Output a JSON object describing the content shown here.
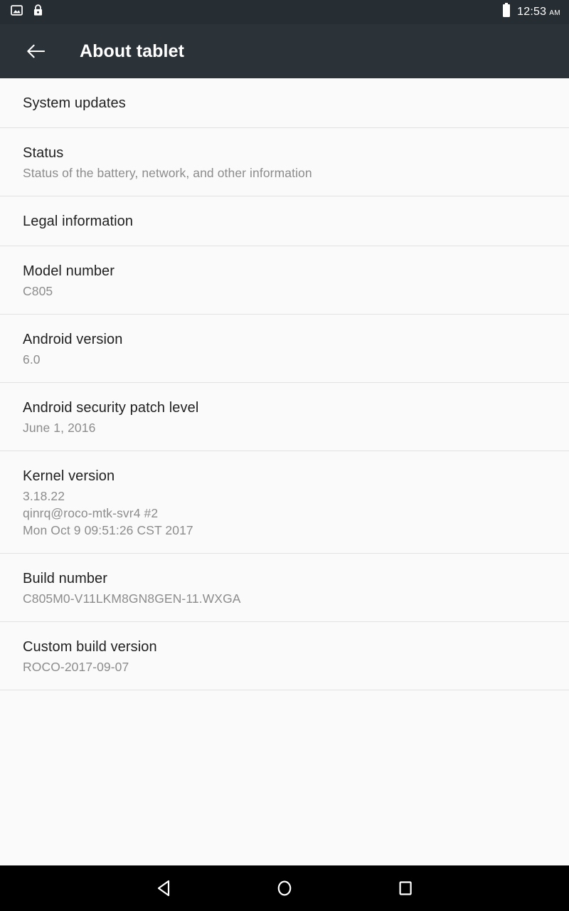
{
  "status_bar": {
    "left_icons": [
      {
        "name": "image-icon",
        "label": "Screenshot captured"
      },
      {
        "name": "lock-icon",
        "label": "Screen lock"
      }
    ],
    "right_icons": [
      {
        "name": "battery-icon",
        "label": "Battery full"
      }
    ],
    "time": "12:53",
    "am_pm": "AM",
    "background_color": "#262d33"
  },
  "app_bar": {
    "back_label": "Navigate up",
    "title": "About tablet",
    "background_color": "#2b3238",
    "title_color": "#ffffff"
  },
  "colors": {
    "page_background": "#fafafa",
    "divider": "#e2e2e2",
    "row_title": "#1f1f1f",
    "row_subtitle": "#8c8c8c",
    "nav_background": "#000000"
  },
  "list": {
    "rows": [
      {
        "title": "System updates",
        "subtitles": []
      },
      {
        "title": "Status",
        "subtitles": [
          "Status of the battery, network, and other information"
        ]
      },
      {
        "title": "Legal information",
        "subtitles": []
      },
      {
        "title": "Model number",
        "subtitles": [
          "C805"
        ]
      },
      {
        "title": "Android version",
        "subtitles": [
          "6.0"
        ]
      },
      {
        "title": "Android security patch level",
        "subtitles": [
          "June 1, 2016"
        ]
      },
      {
        "title": "Kernel version",
        "subtitles": [
          "3.18.22",
          "qinrq@roco-mtk-svr4 #2",
          "Mon Oct 9 09:51:26 CST 2017"
        ]
      },
      {
        "title": "Build number",
        "subtitles": [
          "C805M0-V11LKM8GN8GEN-11.WXGA"
        ]
      },
      {
        "title": "Custom build version",
        "subtitles": [
          "ROCO-2017-09-07"
        ]
      }
    ]
  },
  "nav_bar": {
    "buttons": [
      {
        "name": "back-nav-button",
        "label": "Back"
      },
      {
        "name": "home-nav-button",
        "label": "Home"
      },
      {
        "name": "recents-nav-button",
        "label": "Recent apps"
      }
    ]
  }
}
